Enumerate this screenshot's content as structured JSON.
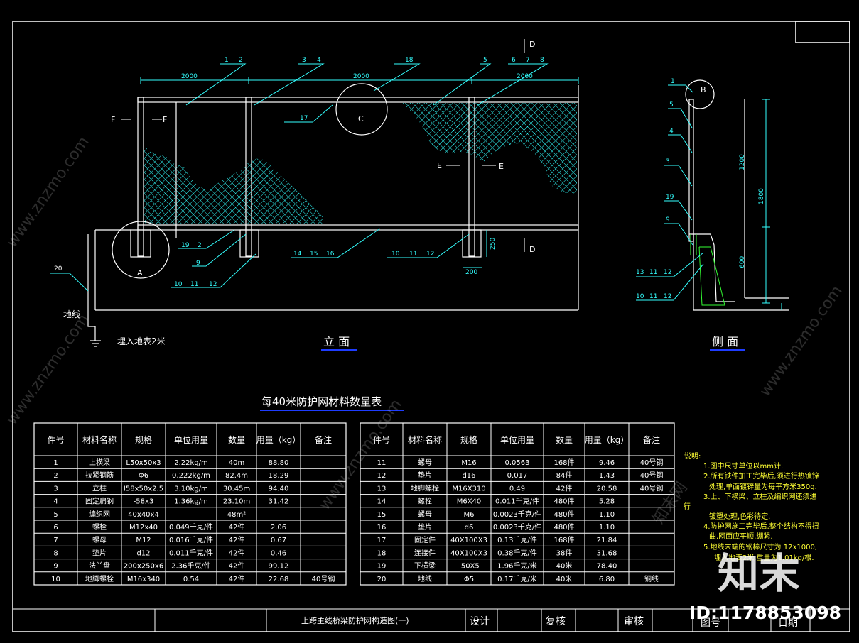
{
  "colors": {
    "background": "#000000",
    "line": "#ffffff",
    "dim": "#33ffff",
    "mesh": "#33ffff",
    "note": "#ffff33",
    "title_underline": "#1e3cff"
  },
  "elevation": {
    "label": "立  面",
    "dims_top": [
      "2000",
      "2000",
      "2000"
    ],
    "dim_bottom": "200",
    "dim_side": "250",
    "callouts_top": [
      "1",
      "2",
      "3",
      "4",
      "18",
      "5",
      "6",
      "7",
      "8"
    ],
    "callout_17": "17",
    "callouts_bottom_left": [
      "19",
      "2",
      "9"
    ],
    "callouts_bottom_left2": [
      "10",
      "11",
      "12"
    ],
    "callouts_bottom_mid": [
      "14",
      "15",
      "16"
    ],
    "callouts_bottom_right": [
      "10",
      "11",
      "12"
    ],
    "detail_labels": {
      "A": "A",
      "C": "C"
    },
    "section_labels": {
      "D": "D",
      "E": "E",
      "F": "F"
    },
    "callout_20": "20",
    "ground_label": "地线",
    "bury_label": "埋入地表2米"
  },
  "side": {
    "label": "侧  面",
    "detail": "B",
    "dims": [
      "1200",
      "1800",
      "600"
    ],
    "callouts": [
      "1",
      "5",
      "4",
      "3",
      "19",
      "9"
    ],
    "callouts_bottom1": [
      "13",
      "11",
      "12"
    ],
    "callouts_bottom2": [
      "10",
      "11",
      "12"
    ]
  },
  "table_title": "每40米防护网材料数量表",
  "table": {
    "headers": [
      "件号",
      "材料名称",
      "规格",
      "单位用量",
      "数量",
      "用量（kg）",
      "备注"
    ],
    "left_rows": [
      [
        "1",
        "上横梁",
        "L50x50x3",
        "2.22kg/m",
        "40m",
        "88.80",
        ""
      ],
      [
        "2",
        "拉紧钢筋",
        "Φ6",
        "0.222kg/m",
        "82.4m",
        "18.29",
        ""
      ],
      [
        "3",
        "立柱",
        "I58x50x2.5",
        "3.10kg/m",
        "30.45m",
        "94.40",
        ""
      ],
      [
        "4",
        "固定扁钢",
        "-58x3",
        "1.36kg/m",
        "23.10m",
        "31.42",
        ""
      ],
      [
        "5",
        "编织网",
        "40x40x4",
        "",
        "48m²",
        "",
        ""
      ],
      [
        "6",
        "螺栓",
        "M12x40",
        "0.049千克/件",
        "42件",
        "2.06",
        ""
      ],
      [
        "7",
        "螺母",
        "M12",
        "0.016千克/件",
        "42件",
        "0.67",
        ""
      ],
      [
        "8",
        "垫片",
        "d12",
        "0.011千克/件",
        "42件",
        "0.46",
        ""
      ],
      [
        "9",
        "法兰盘",
        "200x250x6",
        "2.36千克/件",
        "42件",
        "99.12",
        ""
      ],
      [
        "10",
        "地脚螺栓",
        "M16x340",
        "0.54",
        "42件",
        "22.68",
        "40号钢"
      ]
    ],
    "right_rows": [
      [
        "11",
        "螺母",
        "M16",
        "0.0563",
        "168件",
        "9.46",
        "40号钢"
      ],
      [
        "12",
        "垫片",
        "d16",
        "0.017",
        "84件",
        "1.43",
        "40号钢"
      ],
      [
        "13",
        "地脚螺栓",
        "M16X310",
        "0.49",
        "42件",
        "20.58",
        "40号钢"
      ],
      [
        "14",
        "螺栓",
        "M6X40",
        "0.011千克/件",
        "480件",
        "5.28",
        ""
      ],
      [
        "15",
        "螺母",
        "M6",
        "0.0023千克/件",
        "480件",
        "1.10",
        ""
      ],
      [
        "16",
        "垫片",
        "d6",
        "0.0023千克/件",
        "480件",
        "1.10",
        ""
      ],
      [
        "17",
        "固定件",
        "40X100X3",
        "0.13千克/件",
        "168件",
        "21.84",
        ""
      ],
      [
        "18",
        "连接件",
        "40X100X3",
        "0.38千克/件",
        "38件",
        "31.68",
        ""
      ],
      [
        "19",
        "下横梁",
        "-50X5",
        "1.96千克/米",
        "40米",
        "78.40",
        ""
      ],
      [
        "20",
        "地线",
        "Φ5",
        "0.17千克/米",
        "40米",
        "6.80",
        "铜线"
      ]
    ]
  },
  "notes": {
    "title": "说明:",
    "lines": [
      "1.图中尺寸单位以mm计.",
      "2.所有铁件加工完毕后,须进行热镀锌",
      "处理,单面镀锌量为每平方米350g.",
      "3.上、下横梁、立柱及编织网还须进",
      "行",
      "镀塑处理,色彩待定.",
      "4.防护网施工完毕后,整个结构不得扭",
      "曲,网面应平顺,绷紧.",
      "5.地线末端的钢棒尺寸为   12x1000,",
      "埋入地表2米,重量为1.01kg/根."
    ]
  },
  "title_block": {
    "drawing_title": "上跨主线桥梁防护网构造图(一)",
    "design": "设计",
    "review": "复核",
    "audit": "审核",
    "drawing_no": "图号",
    "date": "日期"
  },
  "watermark": {
    "brand": "知末",
    "id_text": "ID:1178853098",
    "site": "www.znzmo.com",
    "cn": "知末网"
  }
}
